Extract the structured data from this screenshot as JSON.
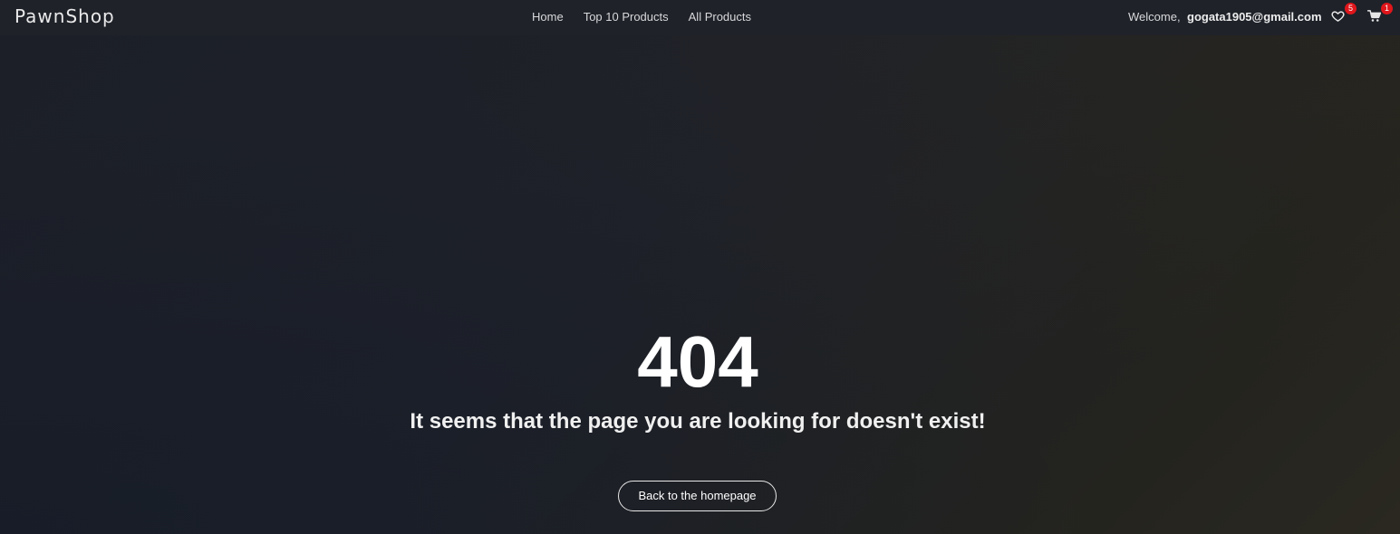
{
  "header": {
    "brand": "PawnShop",
    "nav": [
      {
        "label": "Home"
      },
      {
        "label": "Top 10 Products"
      },
      {
        "label": "All Products"
      }
    ],
    "welcome_label": "Welcome,",
    "user_email": "gogata1905@gmail.com",
    "wishlist": {
      "icon": "heart-icon",
      "count": "5"
    },
    "cart": {
      "icon": "cart-icon",
      "count": "1"
    }
  },
  "error": {
    "code": "404",
    "message": "It seems that the page you are looking for doesn't exist!",
    "button_label": "Back to the homepage"
  },
  "colors": {
    "background": "#1e2129",
    "navbar": "#1f2229",
    "badge": "#e0161b",
    "text": "#ffffff"
  }
}
